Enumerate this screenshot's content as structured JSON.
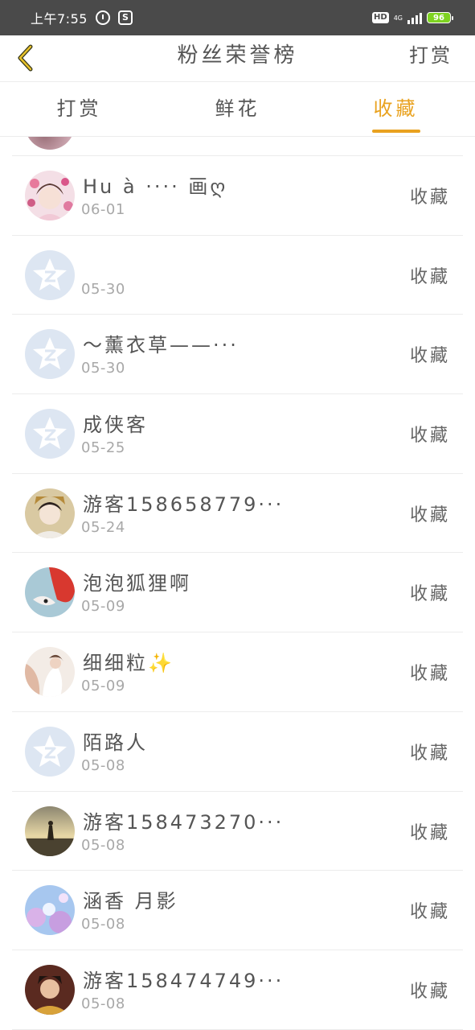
{
  "status_bar": {
    "time": "上午7:55",
    "app_icon_text": "S",
    "hd": "HD",
    "network": "4G",
    "battery": "96"
  },
  "header": {
    "back_icon": "chevron-left-icon",
    "title": "粉丝荣誉榜",
    "action": "打赏"
  },
  "tabs": [
    {
      "label": "打赏",
      "active": false
    },
    {
      "label": "鲜花",
      "active": false
    },
    {
      "label": "收藏",
      "active": true
    }
  ],
  "accent_color": "#e9a21f",
  "list": [
    {
      "name": "Hu à ···· 画ღ",
      "date": "06-01",
      "action": "收藏",
      "avatar": "photo-girl-pink"
    },
    {
      "name": "",
      "date": "05-30",
      "action": "收藏",
      "avatar": "default"
    },
    {
      "name": "～薰衣草——···",
      "date": "05-30",
      "action": "收藏",
      "avatar": "default"
    },
    {
      "name": "成侠客",
      "date": "05-25",
      "action": "收藏",
      "avatar": "default"
    },
    {
      "name": "游客158658779···",
      "date": "05-24",
      "action": "收藏",
      "avatar": "photo-costume-lady"
    },
    {
      "name": "泡泡狐狸啊",
      "date": "05-09",
      "action": "收藏",
      "avatar": "photo-fox"
    },
    {
      "name": "细细粒✨",
      "date": "05-09",
      "action": "收藏",
      "avatar": "photo-pale"
    },
    {
      "name": "陌路人",
      "date": "05-08",
      "action": "收藏",
      "avatar": "default"
    },
    {
      "name": "游客158473270···",
      "date": "05-08",
      "action": "收藏",
      "avatar": "photo-sunset"
    },
    {
      "name": "涵香 月影",
      "date": "05-08",
      "action": "收藏",
      "avatar": "photo-flowers"
    },
    {
      "name": "游客158474749···",
      "date": "05-08",
      "action": "收藏",
      "avatar": "photo-costume-man"
    }
  ]
}
